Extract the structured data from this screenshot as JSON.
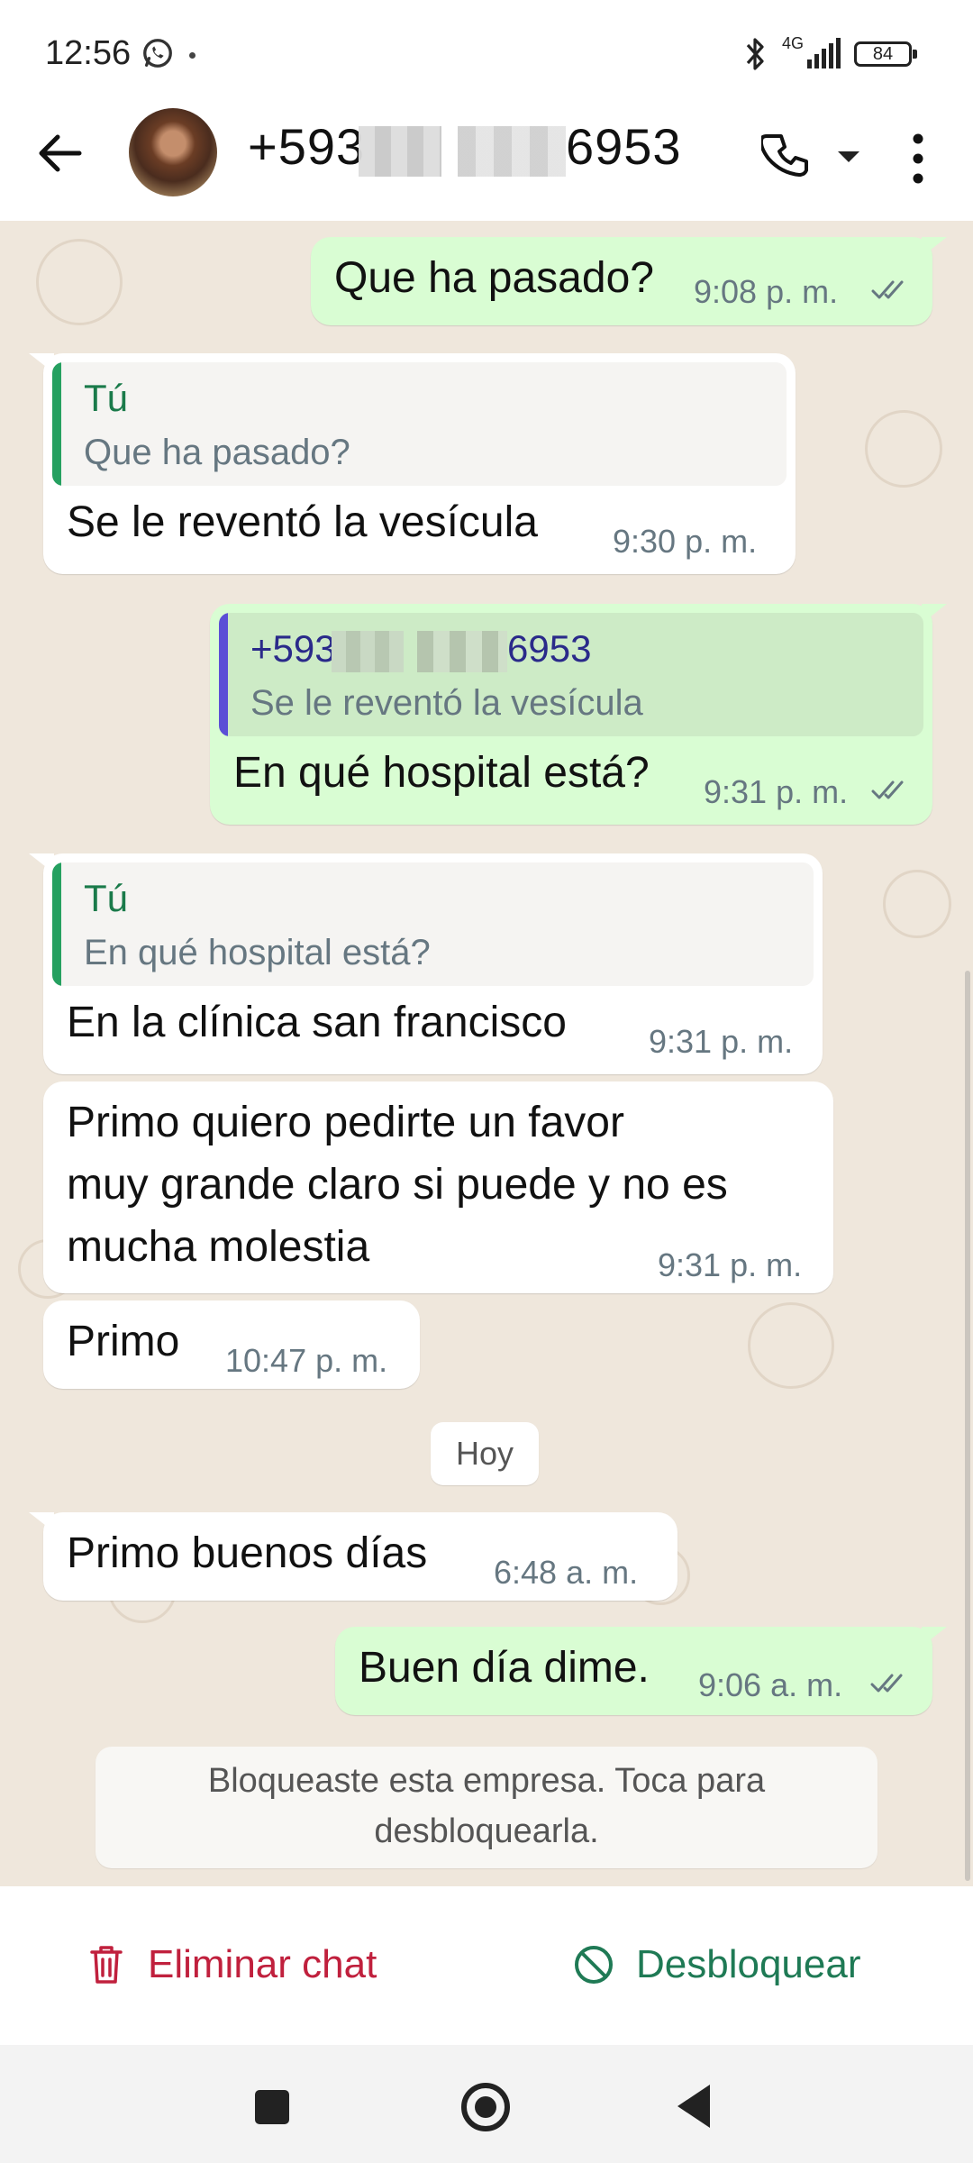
{
  "status_bar": {
    "time": "12:56",
    "network": "4G",
    "battery": "84"
  },
  "header": {
    "contact_prefix": "+593",
    "contact_suffix": "6953",
    "icons": [
      "back-arrow-icon",
      "phone-icon",
      "chevron-down-icon",
      "more-vert-icon"
    ]
  },
  "messages": [
    {
      "dir": "out",
      "text": "Que ha pasado?",
      "time": "9:08 p. m.",
      "read": true
    },
    {
      "dir": "in",
      "quote_name": "Tú",
      "quote_text": "Que ha pasado?",
      "text": "Se le reventó la vesícula",
      "time": "9:30 p. m."
    },
    {
      "dir": "out",
      "quote_name_prefix": "+593",
      "quote_name_suffix": "6953",
      "quote_text": "Se le reventó la vesícula",
      "text": "En qué hospital está?",
      "time": "9:31 p. m.",
      "read": true
    },
    {
      "dir": "in",
      "quote_name": "Tú",
      "quote_text": "En qué hospital está?",
      "text": "En la clínica san francisco",
      "time": "9:31 p. m."
    },
    {
      "dir": "in",
      "text_line1": "Primo quiero pedirte un favor",
      "text_line2": "muy grande claro si puede y no es",
      "text_line3": "mucha molestia",
      "time": "9:31 p. m."
    },
    {
      "dir": "in",
      "text": "Primo",
      "time": "10:47 p. m."
    },
    {
      "dir": "in",
      "text": "Primo buenos días",
      "time": "6:48 a. m."
    },
    {
      "dir": "out",
      "text": "Buen día dime.",
      "time": "9:06 a. m.",
      "read": true
    }
  ],
  "day_separator": "Hoy",
  "notice": {
    "line1": "Bloqueaste esta empresa. Toca para",
    "line2": "desbloquearla."
  },
  "actions": {
    "delete_label": "Eliminar chat",
    "unblock_label": "Desbloquear"
  },
  "colors": {
    "outgoing_bubble": "#d9fdd3",
    "incoming_bubble": "#ffffff",
    "chat_background": "#efe7dc",
    "delete_red": "#c0203d",
    "unblock_green": "#1f7a55",
    "read_ticks": "#667781"
  }
}
